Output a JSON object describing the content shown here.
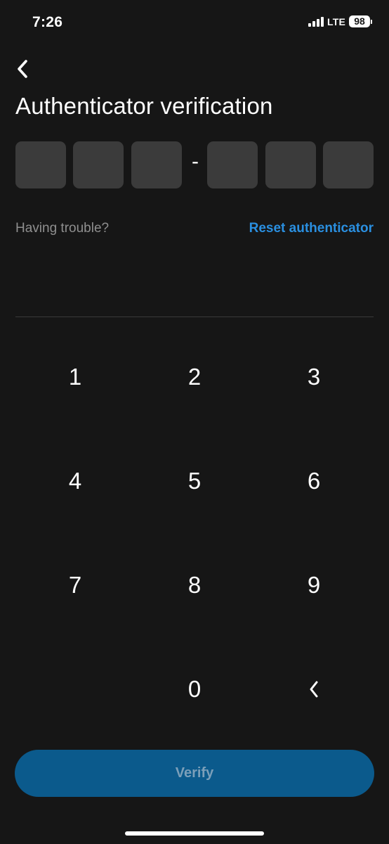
{
  "status_bar": {
    "time": "7:26",
    "network": "LTE",
    "battery": "98"
  },
  "header": {
    "back_icon": "chevron-left-icon",
    "title": "Authenticator verification"
  },
  "code_input": {
    "separator": "-",
    "digits": [
      "",
      "",
      "",
      "",
      "",
      ""
    ]
  },
  "help": {
    "trouble_text": "Having trouble?",
    "reset_link": "Reset authenticator"
  },
  "keypad": {
    "keys": [
      "1",
      "2",
      "3",
      "4",
      "5",
      "6",
      "7",
      "8",
      "9",
      "",
      "0",
      "<"
    ],
    "backspace_icon": "chevron-left-icon"
  },
  "actions": {
    "verify_label": "Verify"
  },
  "colors": {
    "background": "#161616",
    "code_box": "#3b3b3b",
    "link": "#2a8fe0",
    "button": "#0b5a8c",
    "button_text": "#7b9fb9",
    "muted_text": "#8f8f8f"
  }
}
